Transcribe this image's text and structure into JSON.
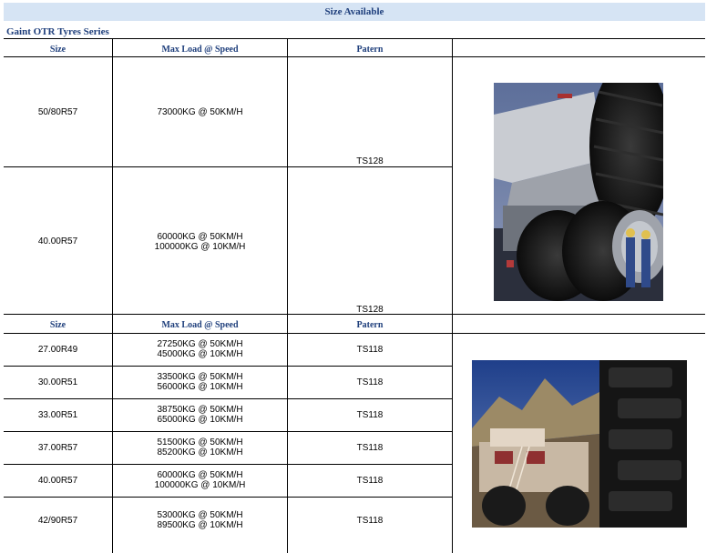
{
  "banner_title": "Size Available",
  "series_title": "Gaint OTR Tyres Series",
  "headers": {
    "size": "Size",
    "load": "Max Load @ Speed",
    "pattern": "Patern"
  },
  "table1": [
    {
      "size": "50/80R57",
      "load1": "73000KG @ 50KM/H",
      "load2": "",
      "pattern": "TS128"
    },
    {
      "size": "40.00R57",
      "load1": "60000KG @ 50KM/H",
      "load2": "100000KG @ 10KM/H",
      "pattern": "TS128"
    }
  ],
  "table2": [
    {
      "size": "27.00R49",
      "load1": "27250KG @ 50KM/H",
      "load2": "45000KG @ 10KM/H",
      "pattern": "TS118"
    },
    {
      "size": "30.00R51",
      "load1": "33500KG @ 50KM/H",
      "load2": "56000KG @ 10KM/H",
      "pattern": "TS118"
    },
    {
      "size": "33.00R51",
      "load1": "38750KG @ 50KM/H",
      "load2": "65000KG @ 10KM/H",
      "pattern": "TS118"
    },
    {
      "size": "37.00R57",
      "load1": "51500KG @ 50KM/H",
      "load2": "85200KG @ 10KM/H",
      "pattern": "TS118"
    },
    {
      "size": "40.00R57",
      "load1": "60000KG @ 50KM/H",
      "load2": "100000KG @ 10KM/H",
      "pattern": "TS118"
    },
    {
      "size": "42/90R57",
      "load1": "53000KG @ 50KM/H",
      "load2": "89500KG @ 10KM/H",
      "pattern": "TS118"
    }
  ]
}
